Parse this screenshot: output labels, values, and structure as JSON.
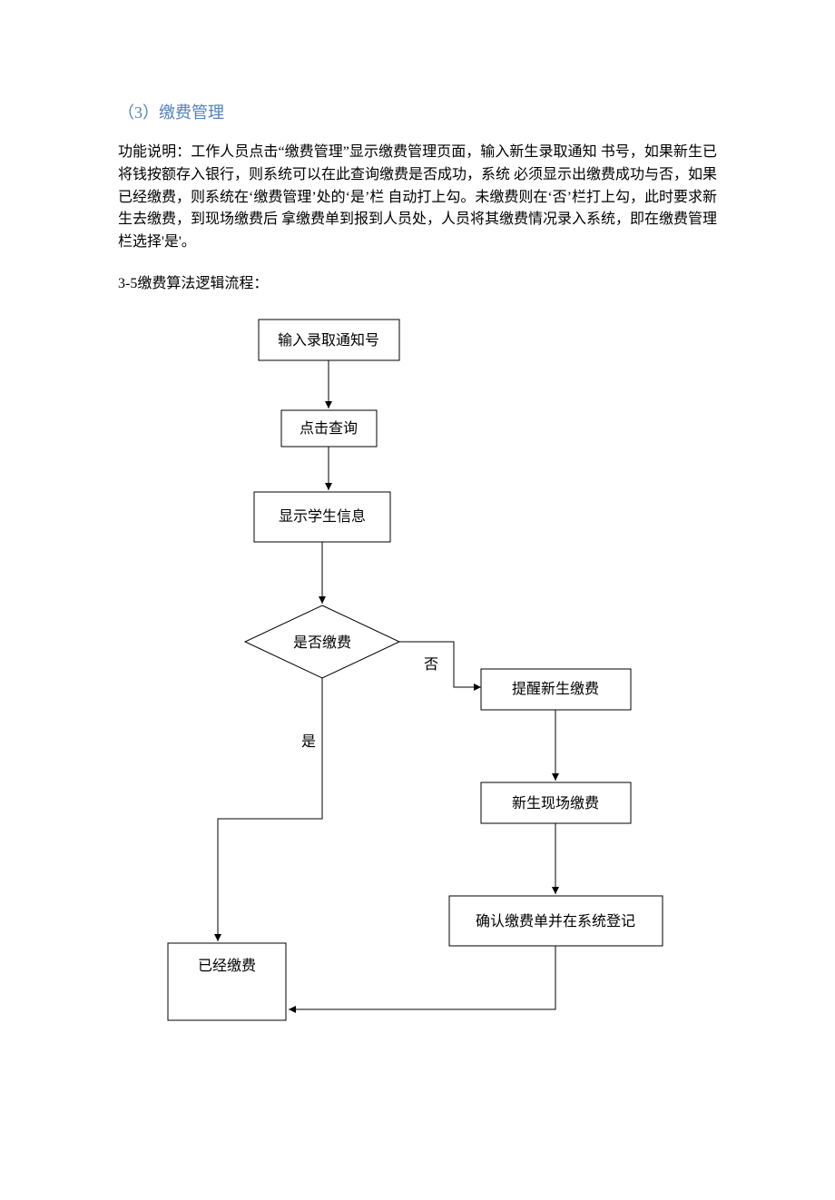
{
  "section_title": "（3）缴费管理",
  "body_text": "功能说明：工作人员点击“缴费管理”显示缴费管理页面，输入新生录取通知 书号，如果新生已将钱按额存入银行，则系统可以在此查询缴费是否成功，系统 必须显示出缴费成功与否，如果已经缴费，则系统在‘缴费管理’处的‘是’栏 自动打上勾。未缴费则在‘否’栏打上勾，此时要求新生去缴费，到现场缴费后 拿缴费单到报到人员处，人员将其缴费情况录入系统，即在缴费管理栏选择'是'。",
  "sub_heading": "3-5缴费算法逻辑流程：",
  "chart_data": {
    "type": "flowchart",
    "nodes": [
      {
        "id": "n1",
        "text": "输入录取通知号",
        "shape": "rect"
      },
      {
        "id": "n2",
        "text": "点击查询",
        "shape": "rect"
      },
      {
        "id": "n3",
        "text": "显示学生信息",
        "shape": "rect"
      },
      {
        "id": "n4",
        "text": "是否缴费",
        "shape": "diamond"
      },
      {
        "id": "n5",
        "text": "提醒新生缴费",
        "shape": "rect"
      },
      {
        "id": "n6",
        "text": "新生现场缴费",
        "shape": "rect"
      },
      {
        "id": "n7",
        "text": "确认缴费单并在系统登记",
        "shape": "rect"
      },
      {
        "id": "n8",
        "text": "已经缴费",
        "shape": "rect"
      }
    ],
    "edges": [
      {
        "from": "n1",
        "to": "n2"
      },
      {
        "from": "n2",
        "to": "n3"
      },
      {
        "from": "n3",
        "to": "n4"
      },
      {
        "from": "n4",
        "to": "n5",
        "label": "否"
      },
      {
        "from": "n4",
        "to": "n8",
        "label": "是"
      },
      {
        "from": "n5",
        "to": "n6"
      },
      {
        "from": "n6",
        "to": "n7"
      },
      {
        "from": "n7",
        "to": "n8"
      }
    ]
  }
}
